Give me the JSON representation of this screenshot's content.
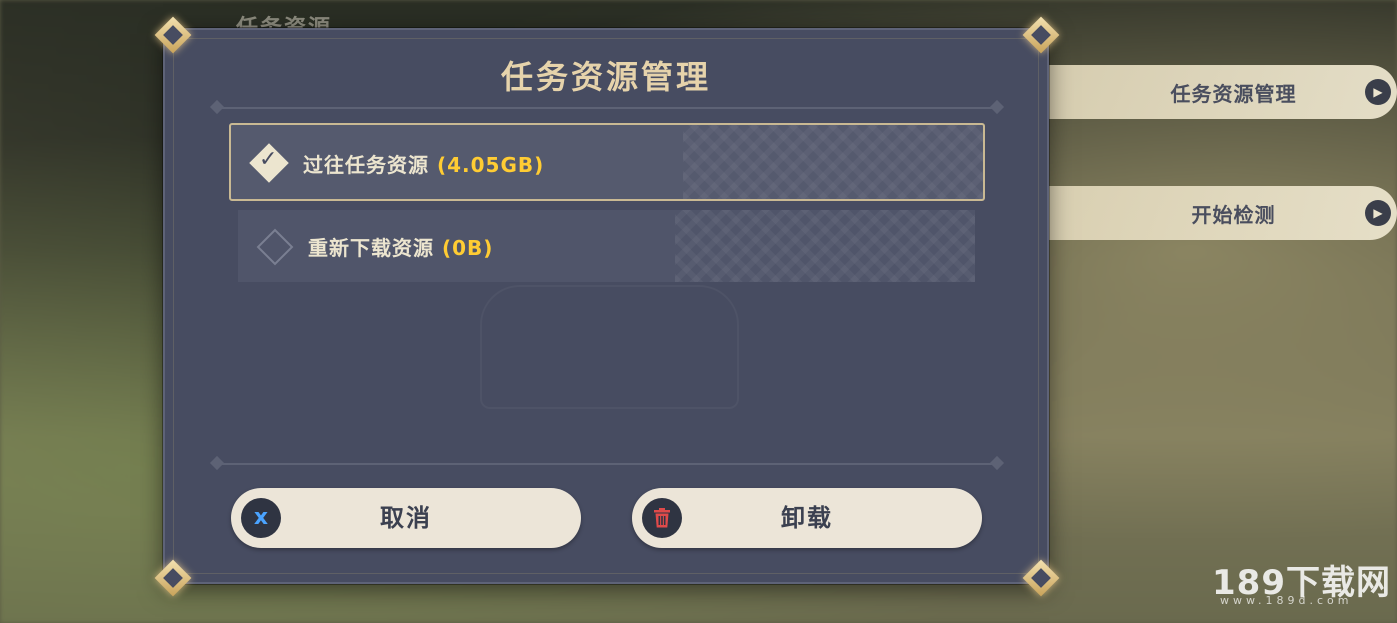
{
  "background": {
    "title": "任务资源"
  },
  "side_menu": [
    {
      "label": "任务资源管理",
      "icon": "play-arrow-icon"
    },
    {
      "label": "开始检测",
      "icon": "play-arrow-icon"
    }
  ],
  "dialog": {
    "title": "任务资源管理",
    "options": [
      {
        "label": "过往任务资源",
        "size": "(4.05GB)",
        "selected": true,
        "icon": "checkmark-diamond-icon"
      },
      {
        "label": "重新下载资源",
        "size": "(0B)",
        "selected": false,
        "icon": "empty-diamond-icon"
      }
    ],
    "cancel_label": "取消",
    "uninstall_label": "卸载",
    "cancel_icon": "x",
    "uninstall_icon": "trash-icon"
  },
  "watermark": {
    "text": "189下载网",
    "url": "www.189d.com"
  },
  "colors": {
    "dialog_bg": "#474c61",
    "accent_gold": "#ffcc33",
    "title_gold": "#e6d3ab",
    "button_bg": "#ece5d8",
    "cancel_icon_color": "#4aa3ff",
    "uninstall_icon_color": "#e04a4a"
  }
}
